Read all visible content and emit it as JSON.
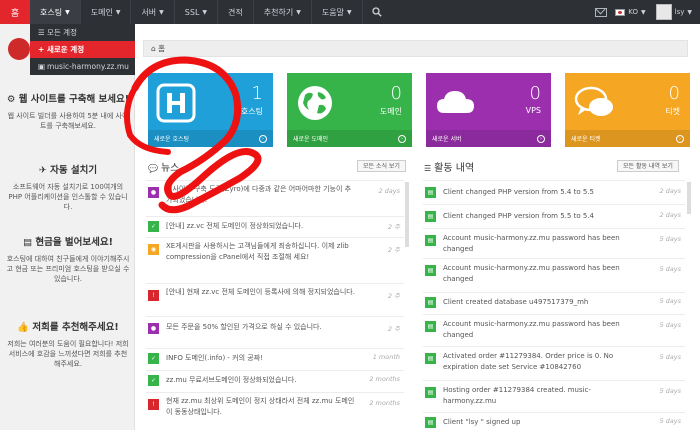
{
  "topnav": {
    "home": "홈",
    "items": [
      {
        "label": "호스팅",
        "caret": true,
        "active": true
      },
      {
        "label": "도메인",
        "caret": true
      },
      {
        "label": "서버",
        "caret": true
      },
      {
        "label": "SSL",
        "caret": true
      },
      {
        "label": "견적",
        "caret": false
      },
      {
        "label": "추천하기",
        "caret": true
      },
      {
        "label": "도움말",
        "caret": true
      }
    ],
    "language": "KO",
    "user": "lsy"
  },
  "dropdown": [
    {
      "label": "모든 계정",
      "icon": "list-icon",
      "glyph": "☰",
      "active": false
    },
    {
      "label": "새로운 계정",
      "icon": "plus-icon",
      "glyph": "+",
      "active": true
    },
    {
      "label": "music-harmony.zz.mu",
      "icon": "server-icon",
      "glyph": "▣",
      "active": false
    }
  ],
  "sidebar": [
    {
      "title": "웹 사이트를 구축해 보세요!",
      "icon": "cogs-icon",
      "glyph": "⚙",
      "desc": "웹 사이트 빌더를 사용하여 5분 내에 사이트를 구축해보세요."
    },
    {
      "title": "자동 설치기",
      "icon": "rocket-icon",
      "glyph": "✈",
      "desc": "소프트웨어 자동 설치기로 100여개의 PHP 어플리케이션을 인스톨할 수 있습니다."
    },
    {
      "title": "현금을 벌어보세요!",
      "icon": "money-icon",
      "glyph": "▤",
      "desc": "호스팅에 대하여 친구들에게 이야기해주시고 현금 또는 프리미엄 호스팅을 받으실 수 있습니다."
    },
    {
      "title": "저희를 추천해주세요!",
      "icon": "thumbs-up-icon",
      "glyph": "👍",
      "desc": "저희는 여러분의 도움이 필요합니다! 저희 서비스에 호감을 느끼셨다면 저희를 추천해주세요."
    }
  ],
  "breadcrumb": "홈",
  "tiles": [
    {
      "count": "1",
      "label": "호스팅",
      "footer": "새로운 호스팅",
      "icon": "hosting-h-icon",
      "color": "#1fa0d8"
    },
    {
      "count": "0",
      "label": "도메인",
      "footer": "새로운 도메인",
      "icon": "globe-icon",
      "color": "#36b449"
    },
    {
      "count": "0",
      "label": "VPS",
      "footer": "새로운 서버",
      "icon": "cloud-icon",
      "color": "#9b2fae"
    },
    {
      "count": "0",
      "label": "티켓",
      "footer": "새로운 티켓",
      "icon": "comments-icon",
      "color": "#f5a623"
    }
  ],
  "news": {
    "title": "뉴스",
    "all_button": "모든 소식 보기",
    "items": [
      {
        "text": "웹사이트 구축 도구(Zyro)에 다중과 같은 어마어마한 기능이 추가되었습니다!",
        "time": "2 days",
        "color": "#9b2fae",
        "glyph": "●"
      },
      {
        "text": "[안내] zz.vc 전체 도메인이 정상화되었습니다.",
        "time": "2 주",
        "color": "#36b449",
        "glyph": "✓"
      },
      {
        "text": "XE게시판을 사용하시는 고객님들에게 죄송하십니다. 이제 zlib compression을 cPanel에서 직접 조절해 세요!",
        "time": "2 주",
        "color": "#f5a623",
        "glyph": "◉"
      },
      {
        "text": "[안내] 현재 zz.vc 전체 도메인이 등록사에 의해 정지되었습니다.",
        "time": "2 주",
        "color": "#d9262c",
        "glyph": "!"
      },
      {
        "text": "모든 주문을 50% 할인된 가격으로 하실 수 있습니다.",
        "time": "2 주",
        "color": "#9b2fae",
        "glyph": "●"
      },
      {
        "text": "INFO 도메인(.info) - 커의 공짜!",
        "time": "1 month",
        "color": "#36b449",
        "glyph": "✓"
      },
      {
        "text": "zz.mu 무료서브도메인이 정상화되었습니다.",
        "time": "2 months",
        "color": "#36b449",
        "glyph": "✓"
      },
      {
        "text": "현재 zz.mu 최상위 도메인이 정지 상태라서 전체 zz.mu 도메인이 동동상태입니다.",
        "time": "2 months",
        "color": "#d9262c",
        "glyph": "!"
      }
    ]
  },
  "activity": {
    "title": "활동 내역",
    "all_button": "모든 활동 내역 보기",
    "items": [
      {
        "text": "Client changed PHP version from 5.4 to 5.5",
        "time": "2 days"
      },
      {
        "text": "Client changed PHP version from 5.5 to 5.4",
        "time": "2 days"
      },
      {
        "text": "Account music-harmony.zz.mu password has been changed",
        "time": "5 days"
      },
      {
        "text": "Account music-harmony.zz.mu password has been changed",
        "time": "5 days"
      },
      {
        "text": "Client created database u497517379_mh",
        "time": "5 days"
      },
      {
        "text": "Account music-harmony.zz.mu password has been changed",
        "time": "5 days"
      },
      {
        "text": "Activated order #11279384. Order price is 0. No expiration date set Service #10842760",
        "time": "5 days"
      },
      {
        "text": "Hosting order #11279384 created. music-harmony.zz.mu",
        "time": "5 days"
      },
      {
        "text": "Client \"lsy \" signed up",
        "time": "5 days"
      }
    ]
  },
  "colors": {
    "brand_red": "#e3262c",
    "nav_dark": "#2d3035",
    "activity_green": "#36b449",
    "scribble": "#ee1111"
  }
}
